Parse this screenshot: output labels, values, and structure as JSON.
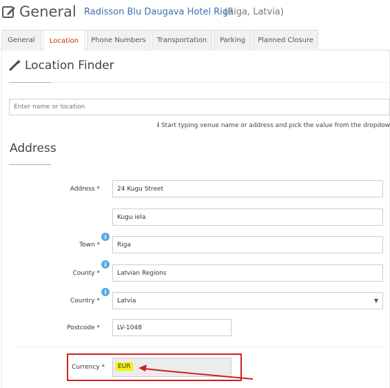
{
  "header": {
    "title": "General",
    "hotel_name": "Radisson Blu Daugava Hotel Riga",
    "hotel_location": "(Riga, Latvia)"
  },
  "tabs": [
    {
      "label": "General"
    },
    {
      "label": "Location",
      "active": true
    },
    {
      "label": "Phone Numbers"
    },
    {
      "label": "Transportation"
    },
    {
      "label": "Parking"
    },
    {
      "label": "Planned Closure"
    }
  ],
  "location_finder": {
    "title": "Location Finder",
    "placeholder": "Enter name or location",
    "hint_icon": "i",
    "hint": "Start typing venue name or address and pick the value from the dropdown."
  },
  "address": {
    "title": "Address",
    "fields": {
      "address_label": "Address",
      "address_line1": "24 Kugu Street",
      "address_line2": "Kugu iela",
      "town_label": "Town",
      "town": "Riga",
      "county_label": "County",
      "county": "Latvian Regions",
      "country_label": "Country",
      "country": "Latvia",
      "postcode_label": "Postcode",
      "postcode": "LV-1048",
      "currency_label": "Currency",
      "currency": "EUR"
    },
    "required_marker": "*",
    "info_icon": "i"
  },
  "colors": {
    "accent": "#3a6fb5",
    "active_tab_text": "#cc3300",
    "highlight_box": "#cc1f1f",
    "highlight_text_bg": "#f3f30a",
    "info_icon": "#5aa9e6"
  },
  "icons": {
    "header": "edit-icon",
    "location_finder": "magic-wand-icon",
    "hint": "info-icon",
    "country_dropdown": "caret-down-icon"
  }
}
